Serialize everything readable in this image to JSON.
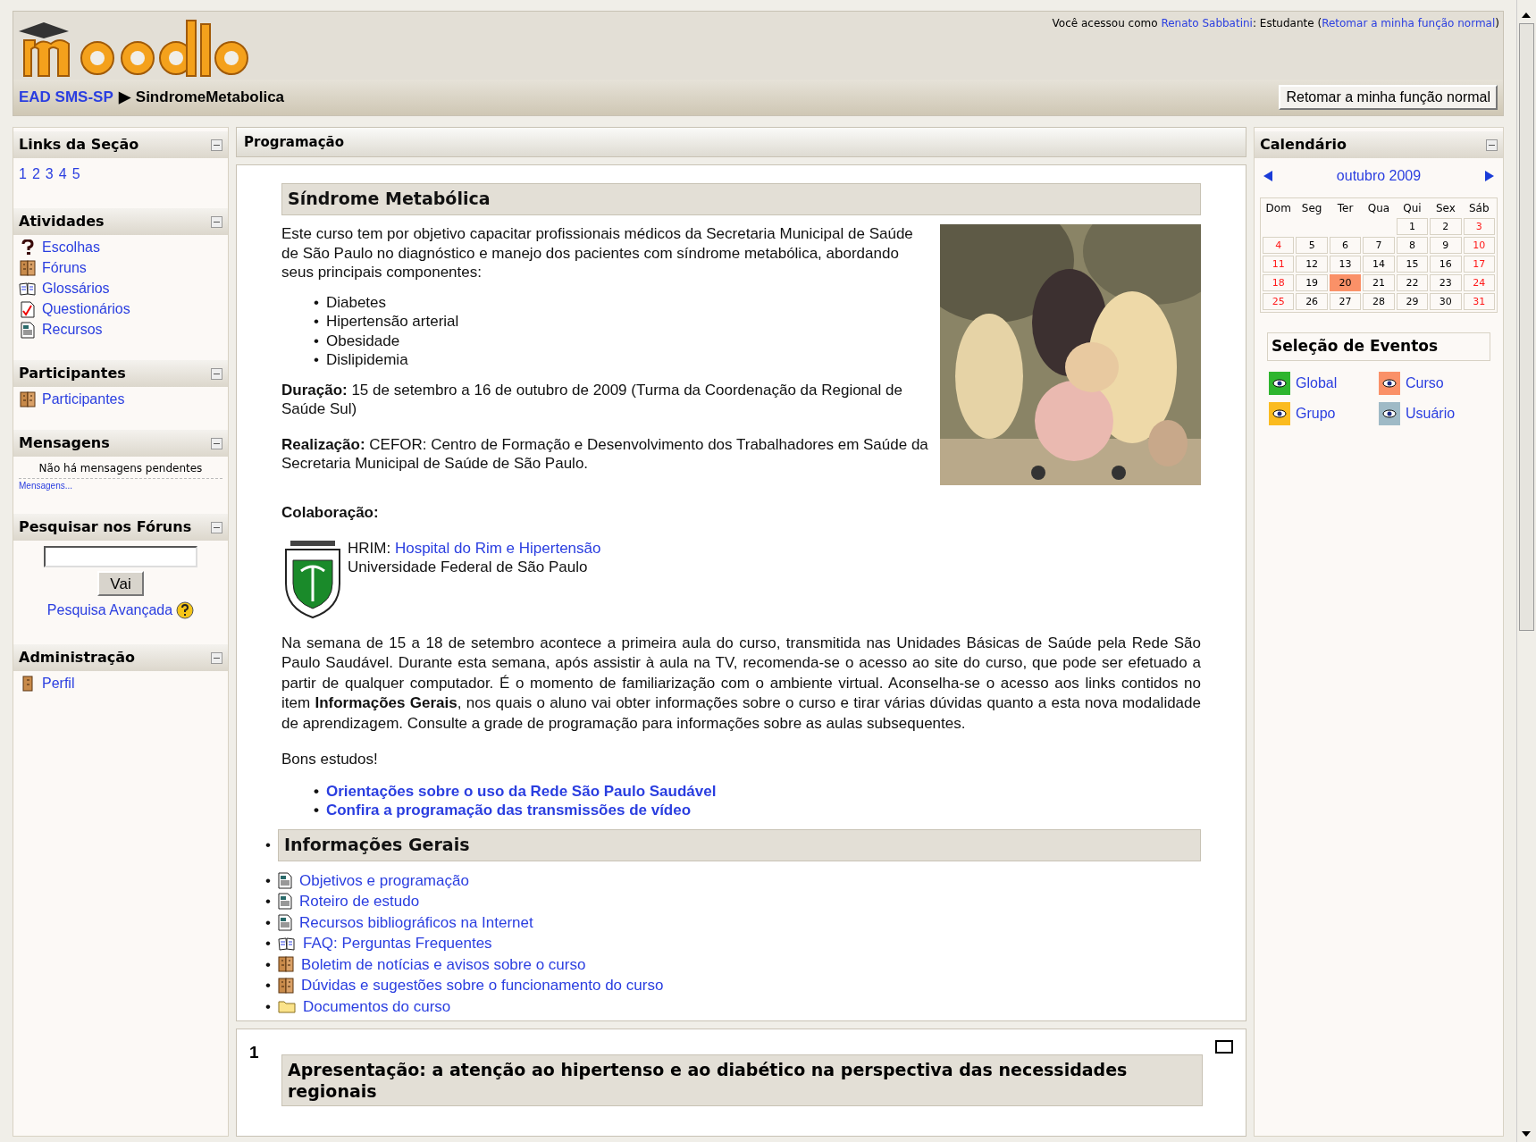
{
  "header": {
    "login_prefix": "Você acessou como",
    "user": "Renato Sabbatini",
    "role": ": Estudante (",
    "return_link": "Retomar a minha função normal",
    "close_paren": ")",
    "breadcrumb": [
      {
        "label": "EAD SMS-SP",
        "link": true
      },
      {
        "label": "SindromeMetabolica",
        "link": false
      }
    ],
    "breadcrumb_sep": "▶",
    "return_button": "Retomar a minha função normal"
  },
  "left_blocks": [
    {
      "kind": "numbers",
      "title": "Links da Seção",
      "items": [
        "1",
        "2",
        "3",
        "4",
        "5"
      ]
    },
    {
      "kind": "links",
      "title": "Atividades",
      "items": [
        {
          "label": "Escolhas",
          "kind": "question"
        },
        {
          "label": "Fóruns",
          "kind": "people"
        },
        {
          "label": "Glossários",
          "kind": "book"
        },
        {
          "label": "Questionários",
          "kind": "check"
        },
        {
          "label": "Recursos",
          "kind": "document"
        }
      ]
    },
    {
      "kind": "links",
      "title": "Participantes",
      "items": [
        {
          "label": "Participantes",
          "kind": "people"
        }
      ]
    },
    {
      "kind": "messages",
      "title": "Mensagens",
      "text": "Não há mensagens pendentes",
      "link": "Mensagens..."
    },
    {
      "kind": "search",
      "title": "Pesquisar nos Fóruns",
      "button": "Vai",
      "link": "Pesquisa Avançada"
    },
    {
      "kind": "links",
      "title": "Administração",
      "items": [
        {
          "label": "Perfil",
          "kind": "person"
        }
      ]
    }
  ],
  "main": {
    "title": "Programação",
    "course": {
      "heading": "Síndrome Metabólica",
      "intro": "Este curso tem por objetivo capacitar profissionais médicos da Secretaria Municipal de Saúde de São Paulo no diagnóstico e manejo dos pacientes com síndrome metabólica, abordando seus principais componentes:",
      "components": [
        {
          "bullet": "•",
          "label": "Diabetes"
        },
        {
          "bullet": "•",
          "label": "Hipertensão arterial"
        },
        {
          "bullet": "•",
          "label": "Obesidade"
        },
        {
          "bullet": "•",
          "label": "Dislipidemia"
        }
      ],
      "duration": "**Duração:** 15 de setembro a 16 de outubro de 2009 (Turma da Coordenação da Regional de Saúde Sul)",
      "realization": "**Realização:** CEFOR: Centro de Formação e Desenvolvimento dos Trabalhadores em Saúde da Secretaria Municipal de Saúde de São Paulo.",
      "collab_label": "Colaboração:",
      "collab_prefix": "HRIM:",
      "collab_link": "Hospital do Rim e Hipertensão",
      "collab_university": "Universidade Federal de São Paulo",
      "paragraph": "Na semana de 15 a 18 de setembro acontece a primeira aula do curso, transmitida nas Unidades Básicas de Saúde pela Rede São Paulo Saudável. Durante esta semana, após assistir à aula na TV, recomenda-se o acesso ao site do curso, que pode ser efetuado a partir de qualquer computador. É o momento de familiarização com o ambiente virtual. Aconselha-se o acesso aos links contidos no item **Informações Gerais**, nos quais o aluno vai obter informações sobre o curso e tirar várias dúvidas quanto a esta nova modalidade de aprendizagem. Consulte a grade de programação para informações sobre as aulas subsequentes.",
      "closing": "Bons estudos!",
      "links": [
        {
          "bullet": "•",
          "label": "Orientações sobre o uso da Rede São Paulo Saudável"
        },
        {
          "bullet": "•",
          "label": "Confira a programação das transmissões de vídeo"
        }
      ]
    },
    "info_bullet": "•",
    "info_heading": "Informações Gerais",
    "resources": [
      {
        "bullet": "•",
        "label": "Objetivos e programação",
        "kind": "document"
      },
      {
        "bullet": "•",
        "label": "Roteiro de estudo",
        "kind": "document"
      },
      {
        "bullet": "•",
        "label": "Recursos bibliográficos na Internet",
        "kind": "document"
      },
      {
        "bullet": "•",
        "label": "FAQ: Perguntas Frequentes",
        "kind": "book"
      },
      {
        "bullet": "•",
        "label": "Boletim de notícias e avisos sobre o curso",
        "kind": "people"
      },
      {
        "bullet": "•",
        "label": "Dúvidas e sugestões sobre o funcionamento do curso",
        "kind": "people"
      },
      {
        "bullet": "•",
        "label": "Documentos do curso",
        "kind": "folder"
      }
    ],
    "section": {
      "number": "1",
      "heading": "Apresentação: a atenção ao hipertenso e ao diabético na perspectiva das necessidades regionais"
    }
  },
  "calendar": {
    "title": "Calendário",
    "month": "outubro 2009",
    "weekdays": [
      "Dom",
      "Seg",
      "Ter",
      "Qua",
      "Qui",
      "Sex",
      "Sáb"
    ],
    "weeks": [
      [
        {
          "day": "1",
          "weekend": false,
          "today": false
        },
        {
          "day": "2",
          "weekend": false,
          "today": false
        },
        {
          "day": "3",
          "weekend": true,
          "today": false
        }
      ],
      [
        {
          "day": "4",
          "weekend": true,
          "today": false
        },
        {
          "day": "5",
          "weekend": false,
          "today": false
        },
        {
          "day": "6",
          "weekend": false,
          "today": false
        },
        {
          "day": "7",
          "weekend": false,
          "today": false
        },
        {
          "day": "8",
          "weekend": false,
          "today": false
        },
        {
          "day": "9",
          "weekend": false,
          "today": false
        },
        {
          "day": "10",
          "weekend": true,
          "today": false
        }
      ],
      [
        {
          "day": "11",
          "weekend": true,
          "today": false
        },
        {
          "day": "12",
          "weekend": false,
          "today": false
        },
        {
          "day": "13",
          "weekend": false,
          "today": false
        },
        {
          "day": "14",
          "weekend": false,
          "today": false
        },
        {
          "day": "15",
          "weekend": false,
          "today": false
        },
        {
          "day": "16",
          "weekend": false,
          "today": false
        },
        {
          "day": "17",
          "weekend": true,
          "today": false
        }
      ],
      [
        {
          "day": "18",
          "weekend": true,
          "today": false
        },
        {
          "day": "19",
          "weekend": false,
          "today": false
        },
        {
          "day": "20",
          "weekend": false,
          "today": true
        },
        {
          "day": "21",
          "weekend": false,
          "today": false
        },
        {
          "day": "22",
          "weekend": false,
          "today": false
        },
        {
          "day": "23",
          "weekend": false,
          "today": false
        },
        {
          "day": "24",
          "weekend": true,
          "today": false
        }
      ],
      [
        {
          "day": "25",
          "weekend": true,
          "today": false
        },
        {
          "day": "26",
          "weekend": false,
          "today": false
        },
        {
          "day": "27",
          "weekend": false,
          "today": false
        },
        {
          "day": "28",
          "weekend": false,
          "today": false
        },
        {
          "day": "29",
          "weekend": false,
          "today": false
        },
        {
          "day": "30",
          "weekend": false,
          "today": false
        },
        {
          "day": "31",
          "weekend": true,
          "today": false
        }
      ]
    ],
    "events_title": "Seleção de Eventos",
    "events": [
      {
        "label": "Global",
        "color": "#2eb52e"
      },
      {
        "label": "Curso",
        "color": "#fa9168"
      },
      {
        "label": "Grupo",
        "color": "#fbbb1f"
      },
      {
        "label": "Usuário",
        "color": "#9fbac6"
      }
    ]
  }
}
